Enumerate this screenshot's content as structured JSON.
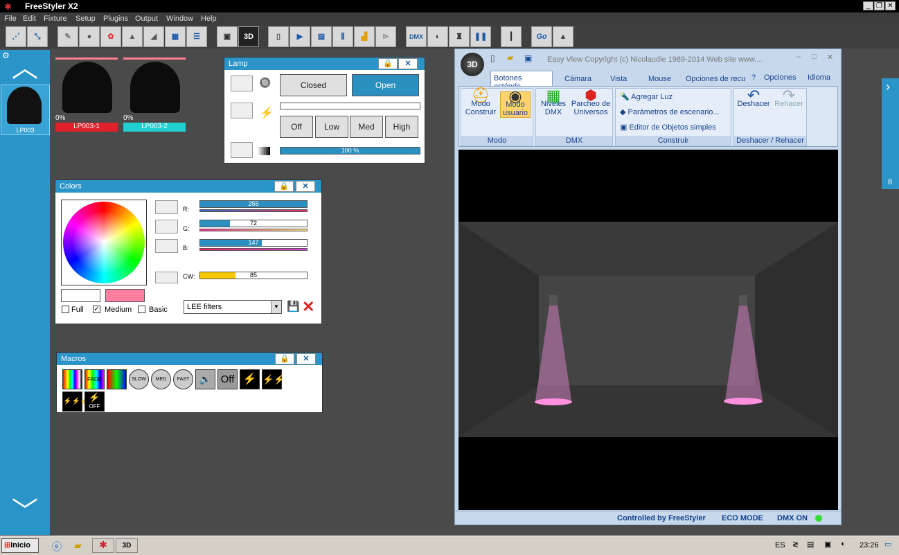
{
  "app": {
    "title": "FreeStyler X2"
  },
  "menu": [
    "File",
    "Edit",
    "Fixture",
    "Setup",
    "Plugins",
    "Output",
    "Window",
    "Help"
  ],
  "toolbar": {
    "go_label": "Go",
    "dmx_label": "DMX"
  },
  "fixtures": [
    {
      "name": "LP003",
      "level": ""
    },
    {
      "name": "LP003-1",
      "level": "0%",
      "color": "#e0202a"
    },
    {
      "name": "LP003-2",
      "level": "0%",
      "color": "#20d0d0"
    }
  ],
  "lamp": {
    "title": "Lamp",
    "closed": "Closed",
    "open": "Open",
    "levels": [
      "Off",
      "Low",
      "Med",
      "High"
    ],
    "dimmer_value": "100 %",
    "dimmer_fraction": 1.0
  },
  "colors": {
    "title": "Colors",
    "channels": [
      {
        "label": "R:",
        "value": "255",
        "fraction": 1.0
      },
      {
        "label": "G:",
        "value": "72",
        "fraction": 0.28
      },
      {
        "label": "B:",
        "value": "147",
        "fraction": 0.58
      },
      {
        "label": "CW:",
        "value": "85",
        "fraction": 0.33
      }
    ],
    "options": [
      "Full",
      "Medium",
      "Basic"
    ],
    "medium_checked": true,
    "filter": "LEE filters",
    "preview_color": "#ff7fa0"
  },
  "macros": {
    "title": "Macros",
    "off_label": "Off",
    "speeds": [
      "SLOW",
      "MED",
      "FAST"
    ],
    "fade_label": "FADE",
    "off2_label": "OFF"
  },
  "easyview": {
    "title": "Easy View   Copyright (c) Nicolaudie 1989-2014   Web site www....",
    "tabs": [
      "Botones estánda",
      "Cámara",
      "Vista",
      "Mouse",
      "Opciones de recu"
    ],
    "right_menu": [
      "?",
      "Opciones",
      "Idioma"
    ],
    "groups": [
      {
        "label": "Modo",
        "items": [
          "Modo\nConstruir",
          "Modo\nusuario"
        ]
      },
      {
        "label": "DMX",
        "items": [
          "Niveles\nDMX",
          "Parcheo de\nUniversos"
        ]
      },
      {
        "label": "Construir",
        "items": [
          "Agregar Luz",
          "Parámetros de escenario...",
          "Editor de Objetos simples"
        ]
      },
      {
        "label": "Deshacer / Rehacer",
        "items": [
          "Deshacer",
          "Rehacer"
        ]
      }
    ],
    "status": [
      "Controlled by FreeStyler",
      "ECO MODE",
      "DMX ON"
    ]
  },
  "right_panel": {
    "number": "8"
  },
  "taskbar": {
    "start": "Inicio",
    "lang": "ES",
    "time": "23:26"
  }
}
